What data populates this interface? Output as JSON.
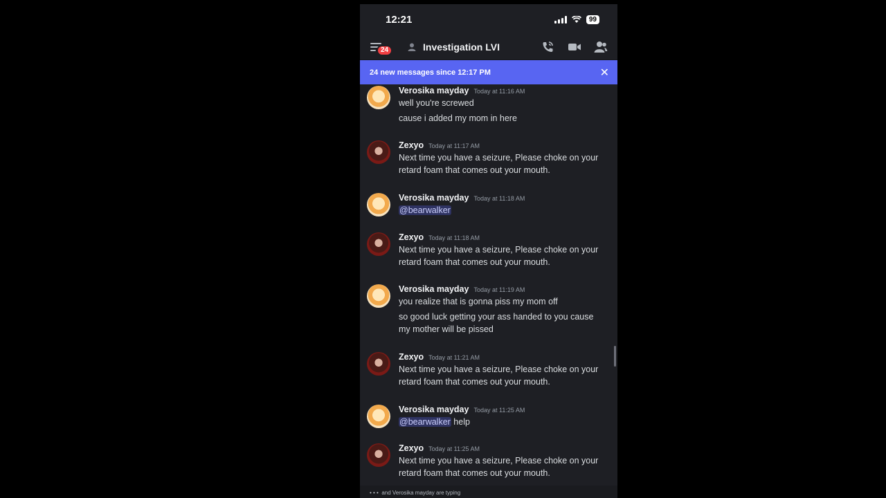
{
  "status_bar": {
    "time": "12:21",
    "battery": "99"
  },
  "header": {
    "unread_badge": "24",
    "channel_name": "Investigation LVI"
  },
  "banner": {
    "text": "24 new messages since 12:17 PM",
    "close": "✕"
  },
  "messages": [
    {
      "author": "Verosika mayday",
      "time": "Today at 11:16 AM",
      "avatar": "verosika-avatar",
      "lines": [
        "well you're screwed",
        "cause i added my mom in here"
      ]
    },
    {
      "author": "Zexyo",
      "time": "Today at 11:17 AM",
      "avatar": "zexyo-avatar",
      "lines": [
        "Next time you have a seizure, Please choke on your",
        "retard foam that comes out your mouth."
      ]
    },
    {
      "author": "Verosika mayday",
      "time": "Today at 11:18 AM",
      "avatar": "verosika-avatar",
      "mention": "@bearwalker"
    },
    {
      "author": "Zexyo",
      "time": "Today at 11:18 AM",
      "avatar": "zexyo-avatar",
      "lines": [
        "Next time you have a seizure, Please choke on your",
        "retard foam that comes out your mouth."
      ]
    },
    {
      "author": "Verosika mayday",
      "time": "Today at 11:19 AM",
      "avatar": "verosika-avatar",
      "lines": [
        "you realize that is gonna piss my mom off",
        "so good luck getting your ass handed to you cause",
        "my mother will be pissed"
      ]
    },
    {
      "author": "Zexyo",
      "time": "Today at 11:21 AM",
      "avatar": "zexyo-avatar",
      "lines": [
        "Next time you have a seizure, Please choke on your",
        "retard foam that comes out your mouth."
      ]
    },
    {
      "author": "Verosika mayday",
      "time": "Today at 11:25 AM",
      "avatar": "verosika-avatar",
      "mention": "@bearwalker",
      "after_mention": " help"
    },
    {
      "author": "Zexyo",
      "time": "Today at 11:25 AM",
      "avatar": "zexyo-avatar",
      "lines": [
        "Next time you have a seizure, Please choke on your",
        "retard foam that comes out your mouth."
      ]
    }
  ],
  "typing": {
    "text": "and Verosika mayday are typing"
  },
  "colors": {
    "banner": "#5865f2",
    "background": "#1e1f24",
    "badge": "#f23f43",
    "mention": "#c9cdfb"
  }
}
